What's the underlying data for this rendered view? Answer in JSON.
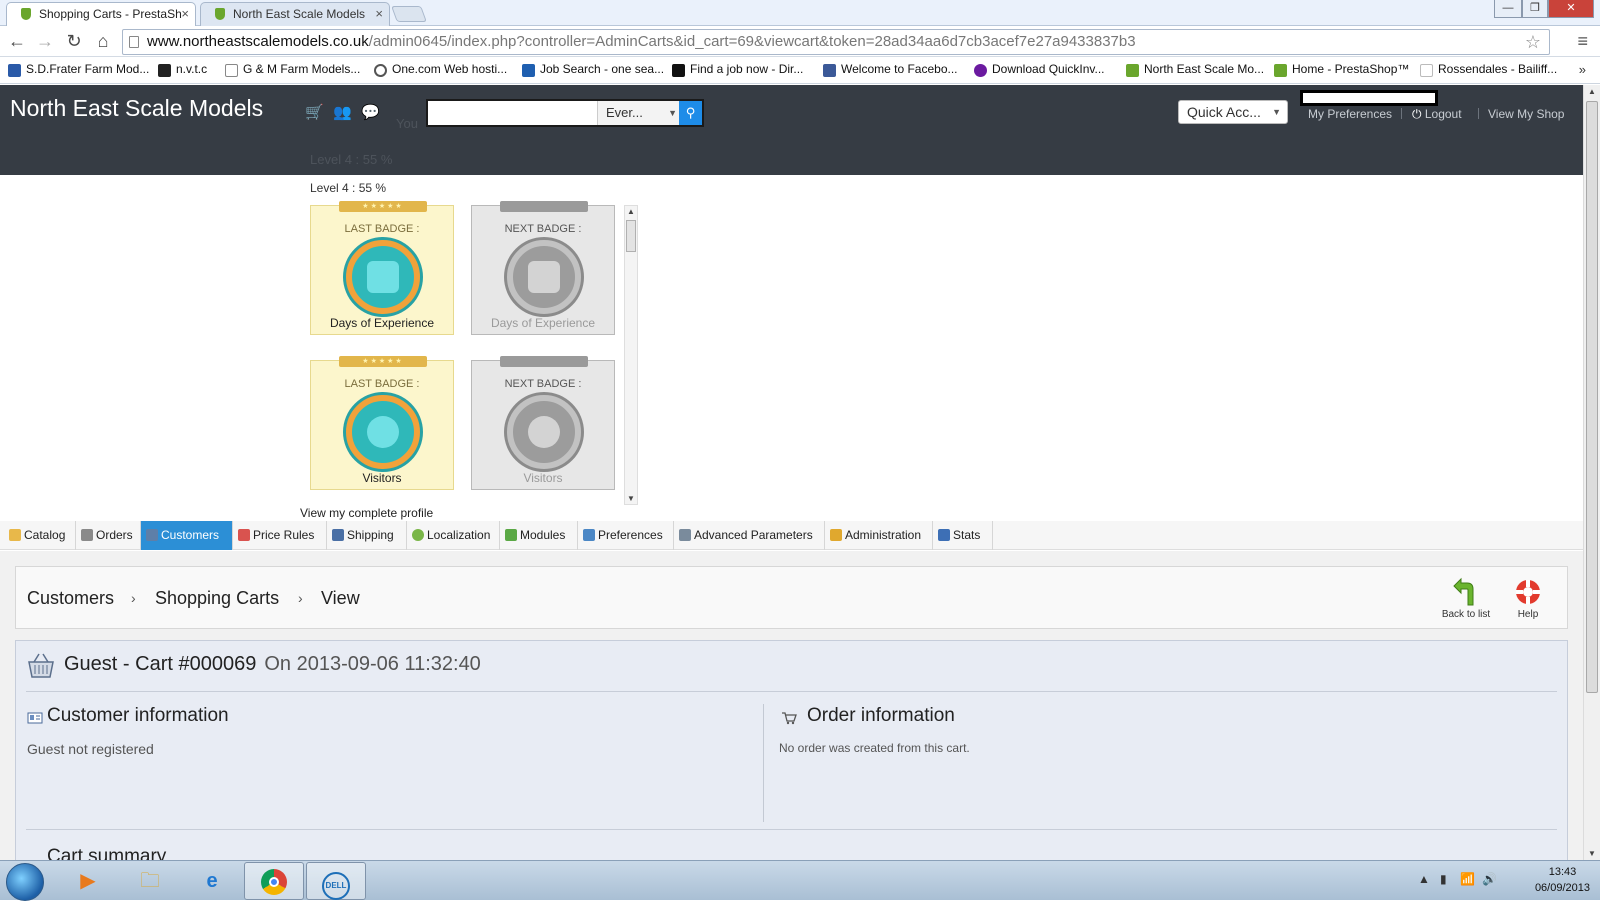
{
  "browser": {
    "tabs": [
      {
        "title": "Shopping Carts - PrestaSh",
        "active": true
      },
      {
        "title": "North East Scale Models",
        "active": false
      }
    ],
    "url_host": "www.northeastscalemodels.co.uk",
    "url_path": "/admin0645/index.php?controller=AdminCarts&id_cart=69&viewcart&token=28ad34aa6d7cb3acef7e27a9433837b3",
    "bookmarks": [
      "S.D.Frater Farm Mod...",
      "n.v.t.c",
      "G & M Farm Models...",
      "One.com Web hosti...",
      "Job Search - one sea...",
      "Find a job now - Dir...",
      "Welcome to Facebo...",
      "Download QuickInv...",
      "North East Scale Mo...",
      "Home - PrestaShop™",
      "Rossendales - Bailiff..."
    ],
    "bookmark_more": "»"
  },
  "header": {
    "shop_name": "North East Scale Models",
    "search_scope": "Ever...",
    "search_placeholder": "",
    "quick_access": "Quick Acc...",
    "my_preferences": "My Preferences",
    "logout": "Logout",
    "view_shop": "View My Shop",
    "ghost_you": "You",
    "ghost_level": "Level 4 : 55 %"
  },
  "badges": {
    "level": "Level 4 : 55 %",
    "items": [
      {
        "title": "LAST BADGE :",
        "name": "Days of Experience",
        "kind": "last"
      },
      {
        "title": "NEXT BADGE :",
        "name": "Days of Experience",
        "kind": "next"
      },
      {
        "title": "LAST BADGE :",
        "name": "Visitors",
        "kind": "last"
      },
      {
        "title": "NEXT BADGE :",
        "name": "Visitors",
        "kind": "next"
      }
    ],
    "profile_link": "View my complete profile"
  },
  "mainnav": [
    {
      "label": "Catalog",
      "color": "#e8b84a"
    },
    {
      "label": "Orders",
      "color": "#8a8a8a"
    },
    {
      "label": "Customers",
      "color": "#5e7fa8"
    },
    {
      "label": "Price Rules",
      "color": "#d9534f"
    },
    {
      "label": "Shipping",
      "color": "#4a6fa5"
    },
    {
      "label": "Localization",
      "color": "#7ab648"
    },
    {
      "label": "Modules",
      "color": "#5aa845"
    },
    {
      "label": "Preferences",
      "color": "#4b87c5"
    },
    {
      "label": "Advanced Parameters",
      "color": "#7a8b9c"
    },
    {
      "label": "Administration",
      "color": "#e0a82e"
    },
    {
      "label": "Stats",
      "color": "#3d6fb5"
    }
  ],
  "active_nav": "Customers",
  "breadcrumb": [
    "Customers",
    "Shopping Carts",
    "View"
  ],
  "toolbar": {
    "back": "Back to list",
    "help": "Help"
  },
  "cart": {
    "title": "Guest - Cart #000069",
    "date": "On 2013-09-06 11:32:40",
    "customer_title": "Customer information",
    "customer_text": "Guest not registered",
    "order_title": "Order information",
    "order_text": "No order was created from this cart.",
    "summary_title": "Cart summary"
  },
  "taskbar": {
    "time": "13:43",
    "date": "06/09/2013"
  }
}
